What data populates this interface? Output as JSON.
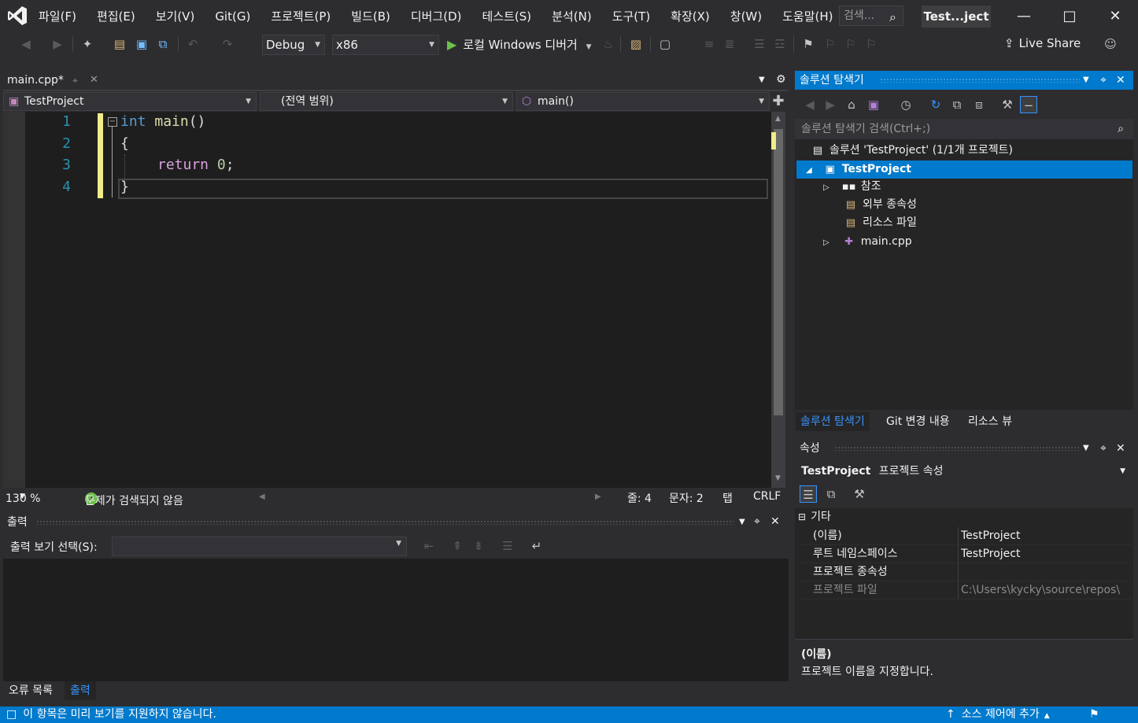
{
  "menu": [
    "파일(F)",
    "편집(E)",
    "보기(V)",
    "Git(G)",
    "프로젝트(P)",
    "빌드(B)",
    "디버그(D)",
    "테스트(S)",
    "분석(N)",
    "도구(T)",
    "확장(X)",
    "창(W)",
    "도움말(H)"
  ],
  "search": {
    "placeholder": "검색..."
  },
  "solution_title": "Test...ject",
  "toolbar": {
    "configuration": "Debug",
    "platform": "x86",
    "run_label": "로컬 Windows 디버거",
    "live_share": "Live Share"
  },
  "editor": {
    "tab_label": "main.cpp*",
    "nav_project": "TestProject",
    "nav_scope": "(전역 범위)",
    "nav_member": "main()",
    "line_numbers": [
      "1",
      "2",
      "3",
      "4"
    ],
    "code": {
      "l1_kw": "int",
      "l1_fn": "main",
      "l1_rest": "()",
      "l2": "{",
      "l3_kw": "return",
      "l3_num": "0",
      "l3_rest": ";",
      "l4": "}"
    },
    "status": {
      "zoom": "130 %",
      "issues": "문제가 검색되지 않음",
      "line": "줄: 4",
      "col": "문자: 2",
      "tabs": "탭",
      "eol": "CRLF"
    }
  },
  "output": {
    "title": "출력",
    "select_label": "출력 보기 선택(S):",
    "tabs": [
      "오류 목록",
      "출력"
    ]
  },
  "solution_explorer": {
    "title": "솔루션 탐색기",
    "search_placeholder": "솔루션 탐색기 검색(Ctrl+;)",
    "tree": {
      "solution": "솔루션 'TestProject' (1/1개 프로젝트)",
      "project": "TestProject",
      "references": "참조",
      "external_deps": "외부 종속성",
      "resource_files": "리소스 파일",
      "main_cpp": "main.cpp"
    },
    "tabs": [
      "솔루션 탐색기",
      "Git 변경 내용",
      "리소스 뷰"
    ]
  },
  "properties": {
    "title": "속성",
    "object_name": "TestProject",
    "object_type": "프로젝트 속성",
    "category": "기타",
    "rows": [
      {
        "name": "(이름)",
        "value": "TestProject"
      },
      {
        "name": "루트 네임스페이스",
        "value": "TestProject"
      },
      {
        "name": "프로젝트 종속성",
        "value": ""
      },
      {
        "name": "프로젝트 파일",
        "value": "C:\\Users\\kycky\\source\\repos\\"
      }
    ],
    "desc_title": "(이름)",
    "desc_text": "프로젝트 이름을 지정합니다."
  },
  "statusbar": {
    "message": "이 항목은 미리 보기를 지원하지 않습니다.",
    "source_control": "소스 제어에 추가"
  },
  "colors": {
    "accent": "#007acc",
    "background": "#2d2d30",
    "editor_bg": "#1e1e1e",
    "keyword": "#569cd6",
    "control_keyword": "#d8a0df",
    "function": "#dcdcaa",
    "number": "#b5cea8",
    "change_marker": "#f0ec89"
  }
}
